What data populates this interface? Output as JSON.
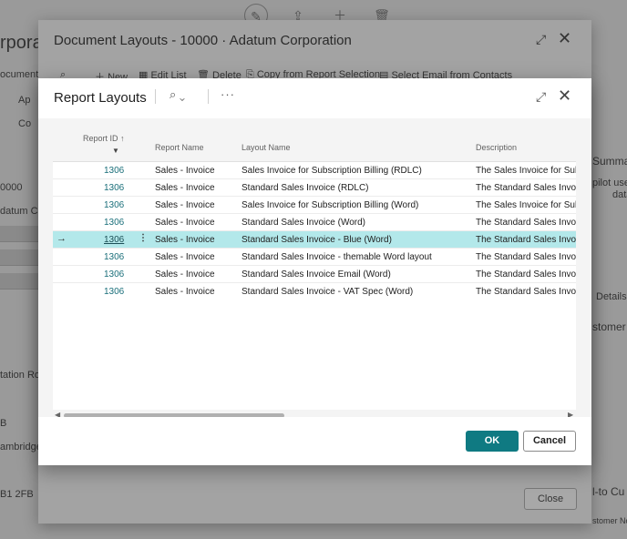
{
  "background": {
    "left_texts": [
      "rpora",
      "ocument",
      "Ap",
      "Co",
      "0000",
      "datum Co",
      "tation Roa",
      "B",
      "ambridge",
      "B1 2FB"
    ],
    "right_texts": [
      "Summar",
      "pilot use",
      "data",
      "Details",
      "stomer",
      "l-to Cu",
      "stomer No"
    ]
  },
  "outer_dialog": {
    "title": "Document Layouts - 10000 · Adatum Corporation",
    "actions": {
      "new": "New",
      "edit_list": "Edit List",
      "delete": "Delete",
      "copy": "Copy from Report Selection",
      "select_email": "Select Email from Contacts"
    },
    "close_label": "Close"
  },
  "modal": {
    "title": "Report Layouts",
    "columns": {
      "report_id": "Report ID",
      "report_name": "Report Name",
      "layout_name": "Layout Name",
      "description": "Description"
    },
    "rows": [
      {
        "id": "1306",
        "name": "Sales - Invoice",
        "layout": "Sales Invoice for Subscription Billing (RDLC)",
        "desc": "The Sales Invoice for Subs"
      },
      {
        "id": "1306",
        "name": "Sales - Invoice",
        "layout": "Standard Sales Invoice (RDLC)",
        "desc": "The Standard Sales Invoice"
      },
      {
        "id": "1306",
        "name": "Sales - Invoice",
        "layout": "Sales Invoice for Subscription Billing (Word)",
        "desc": "The Sales Invoice for Subs"
      },
      {
        "id": "1306",
        "name": "Sales - Invoice",
        "layout": "Standard Sales Invoice (Word)",
        "desc": "The Standard Sales Invoice"
      },
      {
        "id": "1306",
        "name": "Sales - Invoice",
        "layout": "Standard Sales Invoice - Blue (Word)",
        "desc": "The Standard Sales Invoice"
      },
      {
        "id": "1306",
        "name": "Sales - Invoice",
        "layout": "Standard Sales Invoice - themable Word layout",
        "desc": "The Standard Sales Invoice"
      },
      {
        "id": "1306",
        "name": "Sales - Invoice",
        "layout": "Standard Sales Invoice Email (Word)",
        "desc": "The Standard Sales Invoice"
      },
      {
        "id": "1306",
        "name": "Sales - Invoice",
        "layout": "Standard Sales Invoice - VAT Spec (Word)",
        "desc": "The Standard Sales Invoice"
      }
    ],
    "selected_row": 4,
    "ok_label": "OK",
    "cancel_label": "Cancel"
  },
  "colors": {
    "accent": "#0f7a82",
    "selected_row": "#b3e8ea",
    "link": "#1a6f7a"
  },
  "icons": [
    "edit-icon",
    "share-icon",
    "plus-icon",
    "delete-icon",
    "search-icon",
    "more-icon",
    "expand-icon",
    "close-icon",
    "filter-icon",
    "sort-arrow-icon",
    "row-arrow-icon"
  ]
}
